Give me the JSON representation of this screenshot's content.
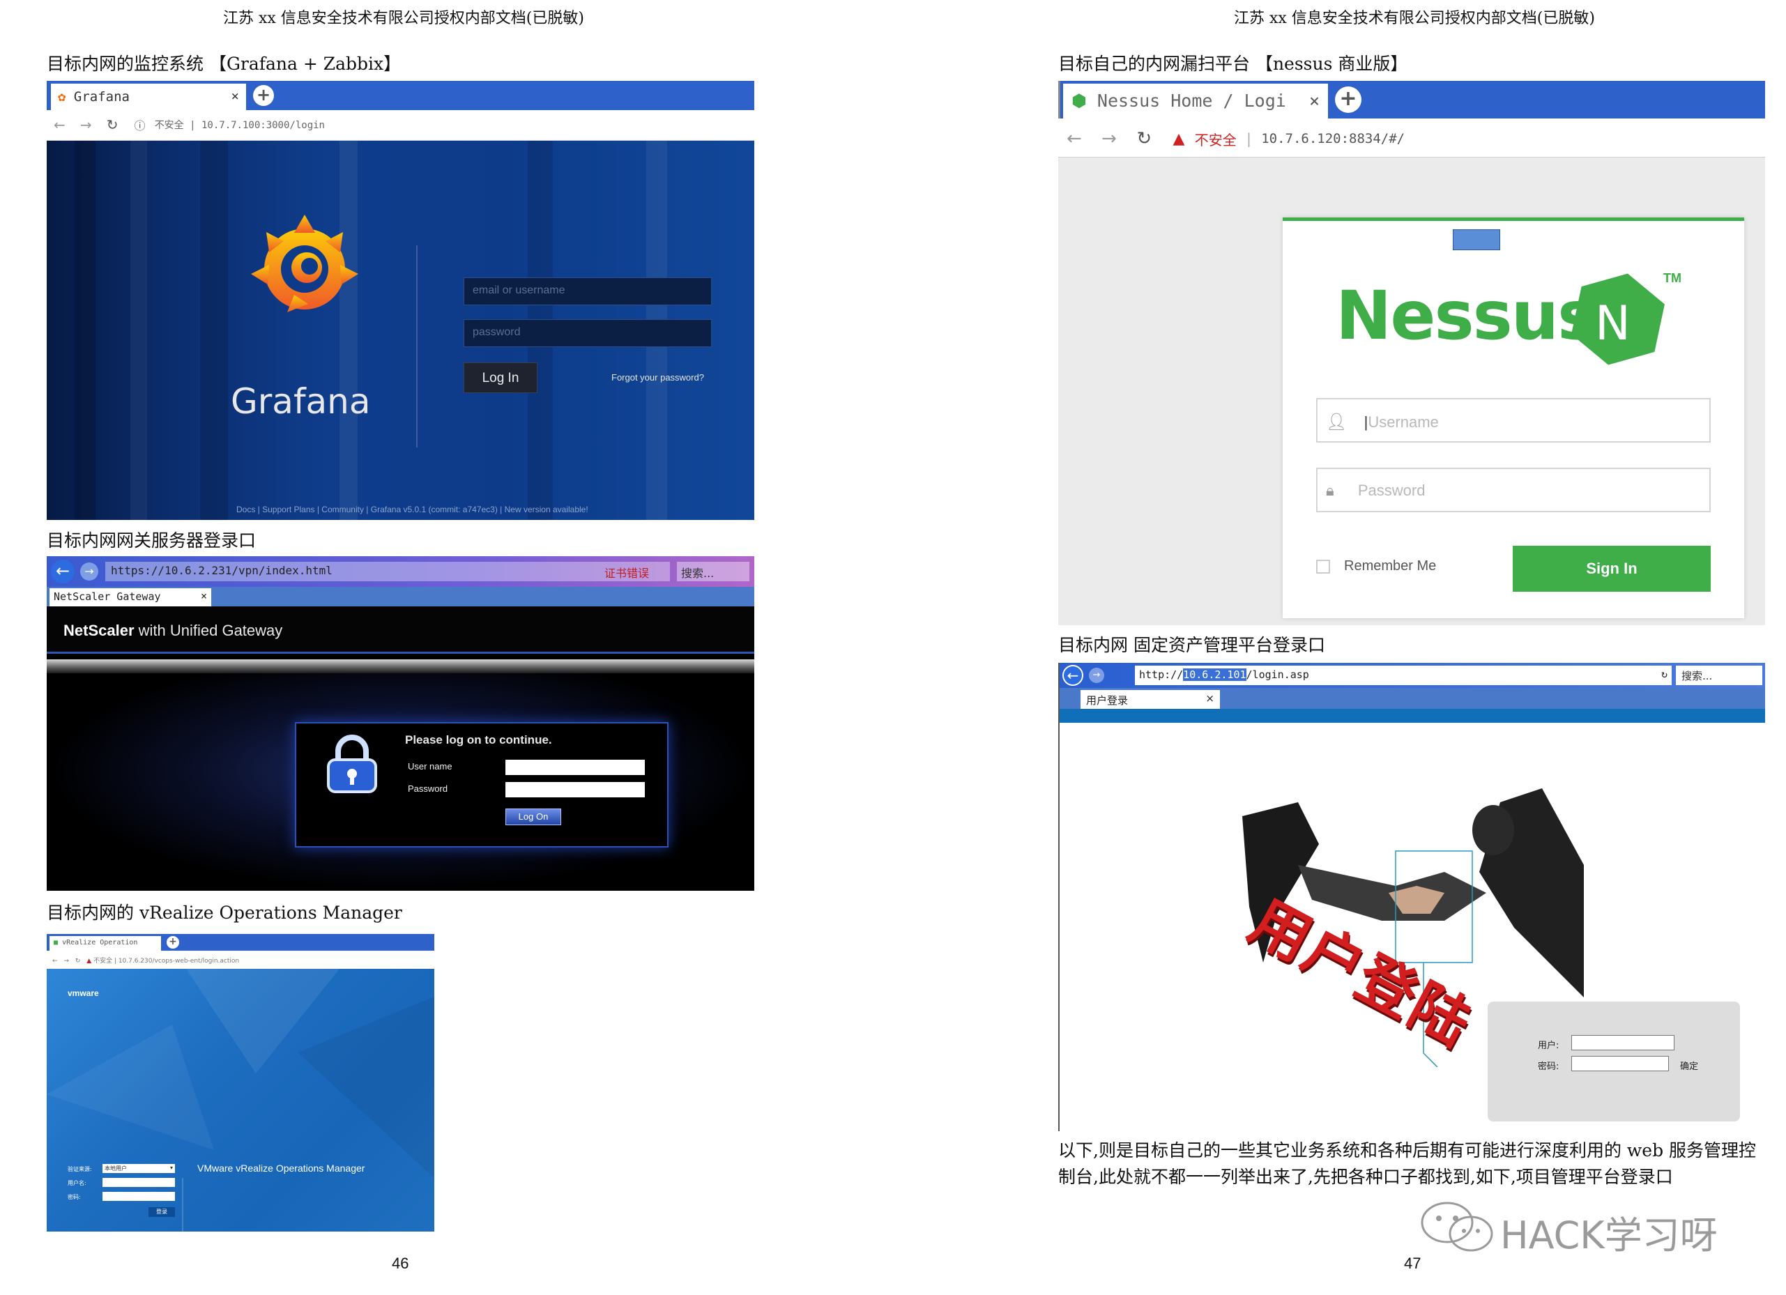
{
  "left_page": {
    "header": "江苏 xx 信息安全技术有限公司授权内部文档(已脱敏)",
    "page_number": "46",
    "grafana_section": {
      "caption": "目标内网的监控系统 【Grafana + Zabbix】",
      "tab_title": "Grafana",
      "address": "不安全 | 10.7.7.100:3000/login",
      "logo_text": "Grafana",
      "email_placeholder": "email or username",
      "password_placeholder": "password",
      "login_button": "Log In",
      "forgot_link": "Forgot your password?",
      "footer": "Docs | Support Plans | Community | Grafana v5.0.1 (commit: a747ec3) | New version available!"
    },
    "netscaler_section": {
      "caption": "目标内网网关服务器登录口",
      "address": "https://10.6.2.231/vpn/index.html",
      "cert_error": "证书错误",
      "search_placeholder": "搜索...",
      "tab_title": "NetScaler Gateway",
      "banner_brand": "NetScaler",
      "banner_rest": " with Unified Gateway",
      "prompt": "Please log on to continue.",
      "username_label": "User name",
      "password_label": "Password",
      "logon_button": "Log On"
    },
    "vrealize_section": {
      "caption": "目标内网的 vRealize Operations Manager",
      "tab_title": "vRealize Operation",
      "address": "不安全 | 10.7.6.230/vcops-web-ent/login.action",
      "brand": "vmware",
      "product": "VMware vRealize Operations Manager",
      "source_label": "验证来源:",
      "source_value": "本地用户",
      "user_label": "用户名:",
      "pass_label": "密码:",
      "login_button": "登录"
    }
  },
  "right_page": {
    "header": "江苏 xx 信息安全技术有限公司授权内部文档(已脱敏)",
    "page_number": "47",
    "nessus_section": {
      "caption": "目标自己的内网漏扫平台 【nessus 商业版】",
      "tab_title": "Nessus Home / Logi",
      "address_warning": "不安全",
      "address": "10.7.6.120:8834/#/",
      "logo_text": "Nessus",
      "logo_letter": "N",
      "tm": "TM",
      "username_placeholder": "Username",
      "password_placeholder": "Password",
      "remember_me": "Remember Me",
      "sign_in": "Sign In"
    },
    "asset_section": {
      "caption": "目标内网 固定资产管理平台登录口",
      "address_prefix": "http://",
      "address_host": "10.6.2.101",
      "address_path": "/login.asp",
      "search_placeholder": "搜索...",
      "tab_title": "用户登录",
      "banner_text": "用户登陆",
      "user_label": "用户:",
      "pass_label": "密码:",
      "confirm_button": "确定"
    },
    "paragraph": "以下,则是目标自己的一些其它业务系统和各种后期有可能进行深度利用的 web 服务管理控制台,此处就不都一一列举出来了,先把各种口子都找到,如下,项目管理平台登录口",
    "watermark": "HACK学习呀"
  },
  "colors": {
    "tab_blue": "#2e61c9",
    "grafana_orange": "#f46800",
    "nessus_green": "#3fae49",
    "netscaler_blue": "#1e3c9a",
    "vrealize_blue": "#1f6fbf",
    "asset_red": "#d21e1e"
  }
}
